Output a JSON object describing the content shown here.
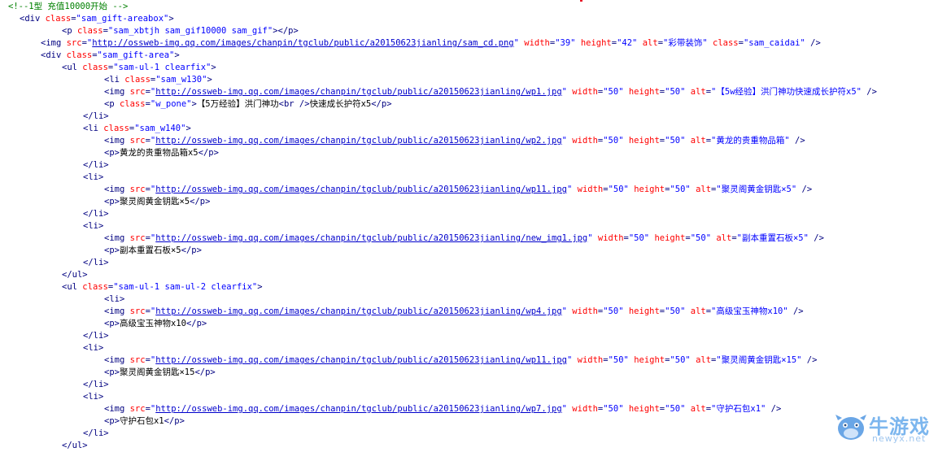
{
  "colors": {
    "comment": "#008000",
    "tag": "#000080",
    "attr": "#ff0000",
    "value": "#0000ff",
    "link": "#0000cc",
    "text": "#000000"
  },
  "source_lines": [
    [
      [
        "c",
        "<!--1型 充值10000开始 -->"
      ]
    ],
    [
      [
        "g",
        "<div "
      ],
      [
        "a",
        "class"
      ],
      [
        "g",
        "="
      ],
      [
        "v",
        "\"sam_gift-areabox\""
      ],
      [
        "g",
        ">"
      ]
    ],
    [
      [
        "g",
        "<p "
      ],
      [
        "a",
        "class"
      ],
      [
        "g",
        "="
      ],
      [
        "v",
        "\"sam_xbtjh sam_gif10000 sam_gif\""
      ],
      [
        "g",
        "></p>"
      ]
    ],
    [
      [
        "g",
        "<img "
      ],
      [
        "a",
        "src"
      ],
      [
        "g",
        "="
      ],
      [
        "v",
        "\""
      ],
      [
        "l",
        "http://ossweb-img.qq.com/images/chanpin/tgclub/public/a20150623jianling/sam_cd.png"
      ],
      [
        "v",
        "\""
      ],
      [
        "t",
        " "
      ],
      [
        "a",
        "width"
      ],
      [
        "g",
        "="
      ],
      [
        "v",
        "\"39\""
      ],
      [
        "t",
        " "
      ],
      [
        "a",
        "height"
      ],
      [
        "g",
        "="
      ],
      [
        "v",
        "\"42\""
      ],
      [
        "t",
        " "
      ],
      [
        "a",
        "alt"
      ],
      [
        "g",
        "="
      ],
      [
        "v",
        "\"彩带装饰\""
      ],
      [
        "t",
        " "
      ],
      [
        "a",
        "class"
      ],
      [
        "g",
        "="
      ],
      [
        "v",
        "\"sam_caidai\""
      ],
      [
        "g",
        " />"
      ]
    ],
    [
      [
        "g",
        "<div "
      ],
      [
        "a",
        "class"
      ],
      [
        "g",
        "="
      ],
      [
        "v",
        "\"sam_gift-area\""
      ],
      [
        "g",
        ">"
      ]
    ],
    [
      [
        "g",
        "<ul "
      ],
      [
        "a",
        "class"
      ],
      [
        "g",
        "="
      ],
      [
        "v",
        "\"sam-ul-1 clearfix\""
      ],
      [
        "g",
        ">"
      ]
    ],
    [
      [
        "g",
        "<li "
      ],
      [
        "a",
        "class"
      ],
      [
        "g",
        "="
      ],
      [
        "v",
        "\"sam_w130\""
      ],
      [
        "g",
        ">"
      ]
    ],
    [
      [
        "g",
        "<img "
      ],
      [
        "a",
        "src"
      ],
      [
        "g",
        "="
      ],
      [
        "v",
        "\""
      ],
      [
        "l",
        "http://ossweb-img.qq.com/images/chanpin/tgclub/public/a20150623jianling/wp1.jpg"
      ],
      [
        "v",
        "\""
      ],
      [
        "t",
        " "
      ],
      [
        "a",
        "width"
      ],
      [
        "g",
        "="
      ],
      [
        "v",
        "\"50\""
      ],
      [
        "t",
        " "
      ],
      [
        "a",
        "height"
      ],
      [
        "g",
        "="
      ],
      [
        "v",
        "\"50\""
      ],
      [
        "t",
        " "
      ],
      [
        "a",
        "alt"
      ],
      [
        "g",
        "="
      ],
      [
        "v",
        "\"【5w经验】洪门神功快速成长护符x5\""
      ],
      [
        "g",
        " />"
      ]
    ],
    [
      [
        "g",
        "<p "
      ],
      [
        "a",
        "class"
      ],
      [
        "g",
        "="
      ],
      [
        "v",
        "\"w_pone\""
      ],
      [
        "g",
        ">"
      ],
      [
        "t",
        "【5万经验】洪门神功"
      ],
      [
        "g",
        "<br />"
      ],
      [
        "t",
        "快速成长护符x5"
      ],
      [
        "g",
        "</p>"
      ]
    ],
    [
      [
        "g",
        "</li>"
      ]
    ],
    [
      [
        "g",
        "<li "
      ],
      [
        "a",
        "class"
      ],
      [
        "g",
        "="
      ],
      [
        "v",
        "\"sam_w140\""
      ],
      [
        "g",
        ">"
      ]
    ],
    [
      [
        "g",
        "<img "
      ],
      [
        "a",
        "src"
      ],
      [
        "g",
        "="
      ],
      [
        "v",
        "\""
      ],
      [
        "l",
        "http://ossweb-img.qq.com/images/chanpin/tgclub/public/a20150623jianling/wp2.jpg"
      ],
      [
        "v",
        "\""
      ],
      [
        "t",
        " "
      ],
      [
        "a",
        "width"
      ],
      [
        "g",
        "="
      ],
      [
        "v",
        "\"50\""
      ],
      [
        "t",
        " "
      ],
      [
        "a",
        "height"
      ],
      [
        "g",
        "="
      ],
      [
        "v",
        "\"50\""
      ],
      [
        "t",
        " "
      ],
      [
        "a",
        "alt"
      ],
      [
        "g",
        "="
      ],
      [
        "v",
        "\"黄龙的贵重物品箱\""
      ],
      [
        "g",
        " />"
      ]
    ],
    [
      [
        "g",
        "<p>"
      ],
      [
        "t",
        "黄龙的贵重物品箱x5"
      ],
      [
        "g",
        "</p>"
      ]
    ],
    [
      [
        "g",
        "</li>"
      ]
    ],
    [
      [
        "g",
        "<li>"
      ]
    ],
    [
      [
        "g",
        "<img "
      ],
      [
        "a",
        "src"
      ],
      [
        "g",
        "="
      ],
      [
        "v",
        "\""
      ],
      [
        "l",
        "http://ossweb-img.qq.com/images/chanpin/tgclub/public/a20150623jianling/wp11.jpg"
      ],
      [
        "v",
        "\""
      ],
      [
        "t",
        " "
      ],
      [
        "a",
        "width"
      ],
      [
        "g",
        "="
      ],
      [
        "v",
        "\"50\""
      ],
      [
        "t",
        " "
      ],
      [
        "a",
        "height"
      ],
      [
        "g",
        "="
      ],
      [
        "v",
        "\"50\""
      ],
      [
        "t",
        " "
      ],
      [
        "a",
        "alt"
      ],
      [
        "g",
        "="
      ],
      [
        "v",
        "\"聚灵阁黄金钥匙×5\""
      ],
      [
        "g",
        " />"
      ]
    ],
    [
      [
        "g",
        "<p>"
      ],
      [
        "t",
        "聚灵阁黄金钥匙×5"
      ],
      [
        "g",
        "</p>"
      ]
    ],
    [
      [
        "g",
        "</li>"
      ]
    ],
    [
      [
        "g",
        "<li>"
      ]
    ],
    [
      [
        "g",
        "<img "
      ],
      [
        "a",
        "src"
      ],
      [
        "g",
        "="
      ],
      [
        "v",
        "\""
      ],
      [
        "l",
        "http://ossweb-img.qq.com/images/chanpin/tgclub/public/a20150623jianling/new_img1.jpg"
      ],
      [
        "v",
        "\""
      ],
      [
        "t",
        " "
      ],
      [
        "a",
        "width"
      ],
      [
        "g",
        "="
      ],
      [
        "v",
        "\"50\""
      ],
      [
        "t",
        " "
      ],
      [
        "a",
        "height"
      ],
      [
        "g",
        "="
      ],
      [
        "v",
        "\"50\""
      ],
      [
        "t",
        " "
      ],
      [
        "a",
        "alt"
      ],
      [
        "g",
        "="
      ],
      [
        "v",
        "\"副本重置石板×5\""
      ],
      [
        "g",
        " />"
      ]
    ],
    [
      [
        "g",
        "<p>"
      ],
      [
        "t",
        "副本重置石板×5"
      ],
      [
        "g",
        "</p>"
      ]
    ],
    [
      [
        "g",
        "</li>"
      ]
    ],
    [
      [
        "g",
        "</ul>"
      ]
    ],
    [
      [
        "g",
        "<ul "
      ],
      [
        "a",
        "class"
      ],
      [
        "g",
        "="
      ],
      [
        "v",
        "\"sam-ul-1 sam-ul-2 clearfix\""
      ],
      [
        "g",
        ">"
      ]
    ],
    [
      [
        "g",
        "<li>"
      ]
    ],
    [
      [
        "g",
        "<img "
      ],
      [
        "a",
        "src"
      ],
      [
        "g",
        "="
      ],
      [
        "v",
        "\""
      ],
      [
        "l",
        "http://ossweb-img.qq.com/images/chanpin/tgclub/public/a20150623jianling/wp4.jpg"
      ],
      [
        "v",
        "\""
      ],
      [
        "t",
        " "
      ],
      [
        "a",
        "width"
      ],
      [
        "g",
        "="
      ],
      [
        "v",
        "\"50\""
      ],
      [
        "t",
        " "
      ],
      [
        "a",
        "height"
      ],
      [
        "g",
        "="
      ],
      [
        "v",
        "\"50\""
      ],
      [
        "t",
        " "
      ],
      [
        "a",
        "alt"
      ],
      [
        "g",
        "="
      ],
      [
        "v",
        "\"高级宝玉神物x10\""
      ],
      [
        "g",
        " />"
      ]
    ],
    [
      [
        "g",
        "<p>"
      ],
      [
        "t",
        "高级宝玉神物x10"
      ],
      [
        "g",
        "</p>"
      ]
    ],
    [
      [
        "g",
        "</li>"
      ]
    ],
    [
      [
        "g",
        "<li>"
      ]
    ],
    [
      [
        "g",
        "<img "
      ],
      [
        "a",
        "src"
      ],
      [
        "g",
        "="
      ],
      [
        "v",
        "\""
      ],
      [
        "l",
        "http://ossweb-img.qq.com/images/chanpin/tgclub/public/a20150623jianling/wp11.jpg"
      ],
      [
        "v",
        "\""
      ],
      [
        "t",
        " "
      ],
      [
        "a",
        "width"
      ],
      [
        "g",
        "="
      ],
      [
        "v",
        "\"50\""
      ],
      [
        "t",
        " "
      ],
      [
        "a",
        "height"
      ],
      [
        "g",
        "="
      ],
      [
        "v",
        "\"50\""
      ],
      [
        "t",
        " "
      ],
      [
        "a",
        "alt"
      ],
      [
        "g",
        "="
      ],
      [
        "v",
        "\"聚灵阁黄金钥匙×15\""
      ],
      [
        "g",
        " />"
      ]
    ],
    [
      [
        "g",
        "<p>"
      ],
      [
        "t",
        "聚灵阁黄金钥匙×15"
      ],
      [
        "g",
        "</p>"
      ]
    ],
    [
      [
        "g",
        "</li>"
      ]
    ],
    [
      [
        "g",
        "<li>"
      ]
    ],
    [
      [
        "g",
        "<img "
      ],
      [
        "a",
        "src"
      ],
      [
        "g",
        "="
      ],
      [
        "v",
        "\""
      ],
      [
        "l",
        "http://ossweb-img.qq.com/images/chanpin/tgclub/public/a20150623jianling/wp7.jpg"
      ],
      [
        "v",
        "\""
      ],
      [
        "t",
        " "
      ],
      [
        "a",
        "width"
      ],
      [
        "g",
        "="
      ],
      [
        "v",
        "\"50\""
      ],
      [
        "t",
        " "
      ],
      [
        "a",
        "height"
      ],
      [
        "g",
        "="
      ],
      [
        "v",
        "\"50\""
      ],
      [
        "t",
        " "
      ],
      [
        "a",
        "alt"
      ],
      [
        "g",
        "="
      ],
      [
        "v",
        "\"守护石包x1\""
      ],
      [
        "g",
        " />"
      ]
    ],
    [
      [
        "g",
        "<p>"
      ],
      [
        "t",
        "守护石包x1"
      ],
      [
        "g",
        "</p>"
      ]
    ],
    [
      [
        "g",
        "</li>"
      ]
    ],
    [
      [
        "g",
        "</ul>"
      ]
    ]
  ],
  "watermark": {
    "icon": "cow-mascot-icon",
    "brand_cn": "牛游戏",
    "brand_en": "newyx.net"
  }
}
